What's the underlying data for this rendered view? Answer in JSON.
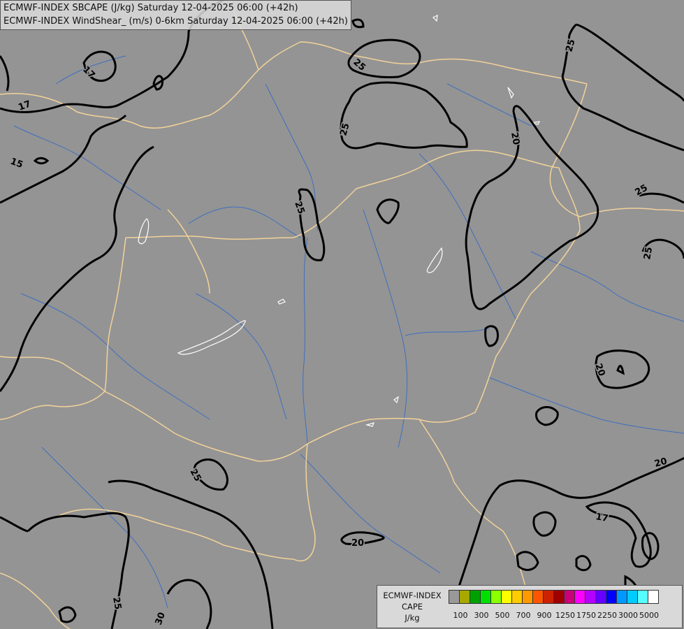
{
  "title": {
    "line1": "ECMWF-INDEX SBCAPE (J/kg) Saturday 12-04-2025 06:00 (+42h)",
    "line2": "ECMWF-INDEX WindShear_ (m/s) 0-6km Saturday 12-04-2025 06:00 (+42h)"
  },
  "legend": {
    "title1": "ECMWF-INDEX",
    "title2": "CAPE",
    "unit": "J/kg",
    "colors": [
      "#999999",
      "#a8a800",
      "#00a000",
      "#00e000",
      "#8cff00",
      "#ffff00",
      "#ffcc00",
      "#ff9900",
      "#ff5500",
      "#cc2200",
      "#a00000",
      "#cc0077",
      "#ff00ff",
      "#b400ff",
      "#6600ff",
      "#0000ff",
      "#0099ff",
      "#00ccff",
      "#55ffff",
      "#ffffff"
    ],
    "labels": [
      "100",
      "300",
      "500",
      "700",
      "900",
      "1250",
      "1750",
      "2250",
      "3000",
      "5000"
    ]
  },
  "contour_labels": [
    "25",
    "17",
    "17",
    "15",
    "25",
    "25",
    "25",
    "20",
    "25",
    "25",
    "20",
    "20",
    "17",
    "25",
    "20",
    "25",
    "30"
  ],
  "colors": {
    "background": "#949494",
    "border": "#f2d299",
    "river": "#3f6fbf",
    "shear_contour": "#000000",
    "cape_contour": "#ffffff"
  }
}
